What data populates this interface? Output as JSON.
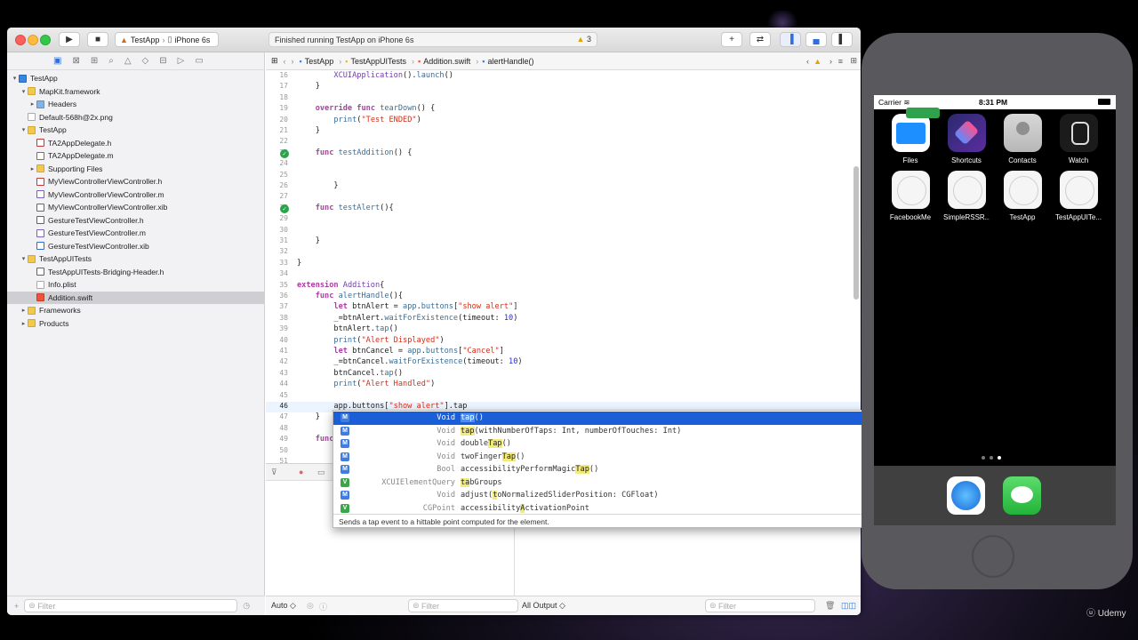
{
  "xcode": {
    "scheme": {
      "project": "TestApp",
      "device": "iPhone 6s"
    },
    "activity": {
      "status": "Finished running TestApp on iPhone 6s",
      "warnings": "3"
    },
    "jumpbar": [
      "TestApp",
      "TestAppUITests",
      "Addition.swift",
      "alertHandle()"
    ],
    "navigator": {
      "tree": [
        {
          "label": "TestApp",
          "level": 0,
          "icon": "proj",
          "disc": "▾"
        },
        {
          "label": "MapKit.framework",
          "level": 1,
          "icon": "folder",
          "disc": "▾"
        },
        {
          "label": "Headers",
          "level": 2,
          "icon": "folder-b",
          "disc": "▸"
        },
        {
          "label": "Default-568h@2x.png",
          "level": 1,
          "icon": "file",
          "disc": ""
        },
        {
          "label": "TestApp",
          "level": 1,
          "icon": "folder",
          "disc": "▾"
        },
        {
          "label": "TA2AppDelegate.h",
          "level": 2,
          "icon": "hfile",
          "disc": ""
        },
        {
          "label": "TA2AppDelegate.m",
          "level": 2,
          "icon": "mfile",
          "disc": ""
        },
        {
          "label": "Supporting Files",
          "level": 2,
          "icon": "folder",
          "disc": "▸"
        },
        {
          "label": "MyViewControllerViewController.h",
          "level": 2,
          "icon": "hfile",
          "disc": ""
        },
        {
          "label": "MyViewControllerViewController.m",
          "level": 2,
          "icon": "mfile",
          "disc": ""
        },
        {
          "label": "MyViewControllerViewController.xib",
          "level": 2,
          "icon": "xib",
          "disc": ""
        },
        {
          "label": "GestureTestViewController.h",
          "level": 2,
          "icon": "hfile",
          "disc": ""
        },
        {
          "label": "GestureTestViewController.m",
          "level": 2,
          "icon": "mfile",
          "disc": ""
        },
        {
          "label": "GestureTestViewController.xib",
          "level": 2,
          "icon": "xib",
          "disc": ""
        },
        {
          "label": "TestAppUITests",
          "level": 1,
          "icon": "folder",
          "disc": "▾"
        },
        {
          "label": "TestAppUITests-Bridging-Header.h",
          "level": 2,
          "icon": "hfile",
          "disc": ""
        },
        {
          "label": "Info.plist",
          "level": 2,
          "icon": "file",
          "disc": ""
        },
        {
          "label": "Addition.swift",
          "level": 2,
          "icon": "swift",
          "disc": "",
          "selected": true
        },
        {
          "label": "Frameworks",
          "level": 1,
          "icon": "folder",
          "disc": "▸"
        },
        {
          "label": "Products",
          "level": 1,
          "icon": "folder",
          "disc": "▸"
        }
      ],
      "filter_placeholder": "Filter"
    },
    "code": [
      {
        "n": "16",
        "html": "        <span class='ty'>XCUIApplication</span>().<span class='fn'>launch</span>()"
      },
      {
        "n": "17",
        "html": "    }"
      },
      {
        "n": "18",
        "html": ""
      },
      {
        "n": "19",
        "html": "    <span class='kw'>override</span> <span class='kw'>func</span> <span class='fn'>tearDown</span>() {"
      },
      {
        "n": "20",
        "html": "        <span class='fn'>print</span>(<span class='str'>\"Test ENDED\"</span>)"
      },
      {
        "n": "21",
        "html": "    }"
      },
      {
        "n": "22",
        "html": ""
      },
      {
        "n": "23",
        "html": "    <span class='kw'>func</span> <span class='fn'>testAddition</span>() {",
        "check": true
      },
      {
        "n": "24",
        "html": ""
      },
      {
        "n": "25",
        "html": ""
      },
      {
        "n": "26",
        "html": "        }"
      },
      {
        "n": "27",
        "html": ""
      },
      {
        "n": "28",
        "html": "    <span class='kw'>func</span> <span class='fn'>testAlert</span>(){",
        "check": true
      },
      {
        "n": "29",
        "html": ""
      },
      {
        "n": "30",
        "html": ""
      },
      {
        "n": "31",
        "html": "    }"
      },
      {
        "n": "32",
        "html": ""
      },
      {
        "n": "33",
        "html": "}"
      },
      {
        "n": "34",
        "html": ""
      },
      {
        "n": "35",
        "html": "<span class='kw'>extension</span> <span class='ty'>Addition</span>{"
      },
      {
        "n": "36",
        "html": "    <span class='kw'>func</span> <span class='fn'>alertHandle</span>(){"
      },
      {
        "n": "37",
        "html": "        <span class='kw'>let</span> btnAlert = <span class='fn'>app</span>.<span class='fn'>buttons</span>[<span class='str'>\"show alert\"</span>]"
      },
      {
        "n": "38",
        "html": "        _=btnAlert.<span class='fn'>waitForExistence</span>(timeout: <span class='num'>10</span>)"
      },
      {
        "n": "39",
        "html": "        btnAlert.<span class='fn'>tap</span>()"
      },
      {
        "n": "40",
        "html": "        <span class='fn'>print</span>(<span class='str'>\"Alert Displayed\"</span>)"
      },
      {
        "n": "41",
        "html": "        <span class='kw'>let</span> btnCancel = <span class='fn'>app</span>.<span class='fn'>buttons</span>[<span class='str'>\"Cancel\"</span>]"
      },
      {
        "n": "42",
        "html": "        _=btnCancel.<span class='fn'>waitForExistence</span>(timeout: <span class='num'>10</span>)"
      },
      {
        "n": "43",
        "html": "        btnCancel.<span class='fn'>tap</span>()"
      },
      {
        "n": "44",
        "html": "        <span class='fn'>print</span>(<span class='str'>\"Alert Handled\"</span>)"
      },
      {
        "n": "45",
        "html": ""
      },
      {
        "n": "46",
        "html": "        app.buttons[<span class='str'>\"show alert\"</span>].tap",
        "current": true
      },
      {
        "n": "47",
        "html": "    }"
      },
      {
        "n": "48",
        "html": ""
      },
      {
        "n": "49",
        "html": "    <span class='kw'>func</span>"
      },
      {
        "n": "50",
        "html": ""
      },
      {
        "n": "51",
        "html": ""
      }
    ],
    "autocomplete": {
      "items": [
        {
          "badge": "M",
          "type": "Void",
          "pre": "",
          "hl": "tap",
          "post": "()",
          "selected": true
        },
        {
          "badge": "M",
          "type": "Void",
          "pre": "",
          "hl": "tap",
          "post": "(withNumberOfTaps: Int, numberOfTouches: Int)"
        },
        {
          "badge": "M",
          "type": "Void",
          "pre": "double",
          "hl": "Tap",
          "post": "()"
        },
        {
          "badge": "M",
          "type": "Void",
          "pre": "twoFinger",
          "hl": "Tap",
          "post": "()"
        },
        {
          "badge": "M",
          "type": "Bool",
          "pre": "accessibilityPerformMagic",
          "hl": "Tap",
          "post": "()"
        },
        {
          "badge": "V",
          "type": "XCUIElementQuery",
          "pre": "",
          "hl": "ta",
          "post": "bGroups"
        },
        {
          "badge": "M",
          "type": "Void",
          "pre": "adjust(",
          "hl": "t",
          "post": "oNormalizedSliderPosition: CGFloat)"
        },
        {
          "badge": "V",
          "type": "CGPoint",
          "pre": "accessibility",
          "hl": "A",
          "post": "ctivationPoint"
        }
      ],
      "doc": "Sends a tap event to a hittable point computed for the element."
    },
    "bottom": {
      "auto": "Auto ◇",
      "filter": "Filter",
      "all_output": "All Output ◇",
      "filter2": "Filter"
    }
  },
  "simulator": {
    "carrier": "Carrier",
    "time": "8:31 PM",
    "apps_row1": [
      {
        "label": "Files",
        "icon": "ic-files"
      },
      {
        "label": "Shortcuts",
        "icon": "ic-shortcuts"
      },
      {
        "label": "Contacts",
        "icon": "ic-contacts"
      },
      {
        "label": "Watch",
        "icon": "ic-watch"
      }
    ],
    "apps_row2": [
      {
        "label": "FacebookMe",
        "icon": "ic-blank"
      },
      {
        "label": "SimpleRSSR...",
        "icon": "ic-blank"
      },
      {
        "label": "TestApp",
        "icon": "ic-blank"
      },
      {
        "label": "TestAppUITe...",
        "icon": "ic-blank"
      }
    ]
  },
  "watermark": "Udemy"
}
